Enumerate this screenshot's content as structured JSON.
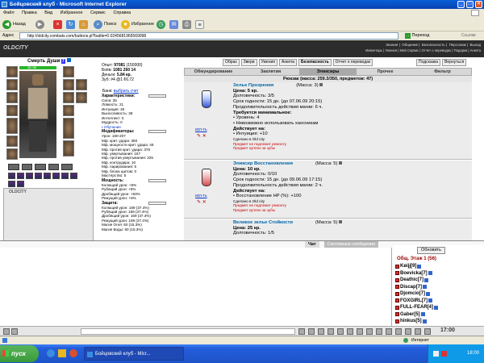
{
  "window": {
    "title": "Бойцовский клуб - Microsoft Internet Explorer",
    "min": "_",
    "max": "□",
    "close": "×"
  },
  "menu": [
    "Файл",
    "Правка",
    "Вид",
    "Избранное",
    "Сервис",
    "Справка"
  ],
  "toolbar": {
    "back": "Назад",
    "search": "Поиск",
    "favorites": "Избранное"
  },
  "address": {
    "label": "Адрес",
    "url": "http://oldcity.combats.com/buttons.pl?battle=0.0245681965569098",
    "go": "Переход",
    "links": "Ссылки"
  },
  "game": {
    "logo": "OLDCITY",
    "nav_top": [
      "Знания",
      "Общение",
      "Безопасность",
      "Персонаж",
      "Выход"
    ],
    "nav_bottom": [
      "Инвентарь",
      "Умения",
      "Мой Сервис",
      "Отчет о переводах",
      "Подарки",
      "Анкета"
    ]
  },
  "character": {
    "name": "Смерть Души",
    "level": "7",
    "hp": "48 /48",
    "exp": "97081",
    "exp_next": "(150000)",
    "battles": "1081",
    "wins": "260",
    "losses": "14",
    "money": "5.84 кр.",
    "level_pts": "#4 @1 ¢6.72",
    "bank": "выбрать счет",
    "characteristics_title": "Характеристики:",
    "stats": [
      "Сила: 35",
      "Ловкость: 21",
      "Интуиция: 45",
      "Выносливость: 38",
      "Интеллект: 0",
      "Мудрость: 0"
    ],
    "training": "• Обучение",
    "modifiers_title": "Модификаторы:",
    "modifiers": [
      "Урон: 160-207",
      "Мф. крит. удара: 350",
      "Мф. мощности крит. удара: 46",
      "Мф. против крит. удара: 375",
      "Мф. увертывания: 167",
      "Мф. против увертывания: 225",
      "Мф. контрудара: 10",
      "Мф. парирования: 5",
      "Мф. блока щитом: 0",
      "Мастерство: 5"
    ],
    "power_title": "Мощность:",
    "power": [
      "Колющий урон: +5%",
      "Рубящий урон: +5%",
      "Дробящий урон: +83%",
      "Режущий урон: +5%"
    ],
    "defense_title": "Защита:",
    "defense": [
      "Колющий урон: 169 (37.4%)",
      "Рубящий урон: 169 (37.4%)",
      "Дробящий урон: 169 (37.4%)",
      "Режущий урон: 169 (37.4%)",
      "Магия Огня: 60 (15.3%)",
      "Магия Воды: 60 (15.3%)"
    ]
  },
  "inventory": {
    "left_buttons": [
      "Образ",
      "Звери",
      "Умения",
      "Анкета",
      "Безопасность",
      "Отчет о переводах"
    ],
    "right_buttons": [
      "Подсказка",
      "Вернуться"
    ],
    "tabs": [
      "Обмундирование",
      "Заклятия",
      "Эликсиры",
      "Прочее",
      "Фильтр"
    ],
    "active_tab": "Эликсиры",
    "backpack": "Рюкзак (масса: 259.3/350, предметов: 47)",
    "use_label": "исп-ть",
    "items": [
      {
        "name": "Зелье Прозрения",
        "mass": "(Масса: 3)",
        "lines": [
          {
            "text": "Цена: 5 кр.",
            "cls": "bold"
          },
          {
            "text": "Долговечность: 3/5",
            "cls": ""
          },
          {
            "text": "Срок годности: 15 дн. (до 07.06.09 20:15)",
            "cls": ""
          },
          {
            "text": "Продолжительность действия магии: 6 ч.",
            "cls": ""
          },
          {
            "text": "Требуется минимальное:",
            "cls": "bold"
          },
          {
            "text": "• Уровень: 4",
            "cls": ""
          },
          {
            "text": "• Невозможно использовать хаосникам",
            "cls": ""
          },
          {
            "text": "Действует на:",
            "cls": "bold"
          },
          {
            "text": "• Интуиция: +10",
            "cls": ""
          },
          {
            "text": "Сделано в Old city",
            "cls": "small"
          },
          {
            "text": "Предмет не подлежит ремонту",
            "cls": "small red"
          },
          {
            "text": "Предмет куплен за зубы",
            "cls": "small red"
          }
        ]
      },
      {
        "name": "Эликсир Восстановления",
        "mass": "(Масса: 5)",
        "lines": [
          {
            "text": "Цена: 10 кр.",
            "cls": "bold"
          },
          {
            "text": "Долговечность: 0/10",
            "cls": ""
          },
          {
            "text": "Срок годности: 15 дн. (до 09.06.09 17:15)",
            "cls": ""
          },
          {
            "text": "Продолжительность действия магии: 2 ч.",
            "cls": ""
          },
          {
            "text": "Действует на:",
            "cls": "bold"
          },
          {
            "text": "• Восстановление HP (%): +100",
            "cls": ""
          },
          {
            "text": "Сделано в Old city",
            "cls": "small"
          },
          {
            "text": "Предмет не подлежит ремонту",
            "cls": "small red"
          },
          {
            "text": "Предмет куплен за зубы",
            "cls": "small red"
          }
        ]
      },
      {
        "name": "Великое зелье Стойкости",
        "mass": "(Масса: 5)",
        "lines": [
          {
            "text": "Цена: 25 кр.",
            "cls": "bold"
          },
          {
            "text": "Долговечность: 1/5",
            "cls": ""
          }
        ]
      }
    ]
  },
  "chat": {
    "tab_chat": "Чат",
    "tab_system": "Системные сообщения"
  },
  "online": {
    "refresh": "Обновить",
    "header": "Общ. Этаж 1 (56)",
    "users": [
      {
        "name": "Kвijj[9]"
      },
      {
        "name": "Boevicka[7]"
      },
      {
        "name": "Deathic[7]"
      },
      {
        "name": "Discap[7]"
      },
      {
        "name": "Djomcio[7]"
      },
      {
        "name": "FOXGIRL[7]"
      },
      {
        "name": "FULL-FEAR[4]"
      },
      {
        "name": "Gaber[5]"
      },
      {
        "name": "hinkus[5]"
      }
    ]
  },
  "clock": "17:00",
  "statusbar": {
    "internet": "Интернет"
  },
  "taskbar": {
    "start": "пуск",
    "task": "Бойцовский клуб - Micr...",
    "time": "18:00"
  }
}
